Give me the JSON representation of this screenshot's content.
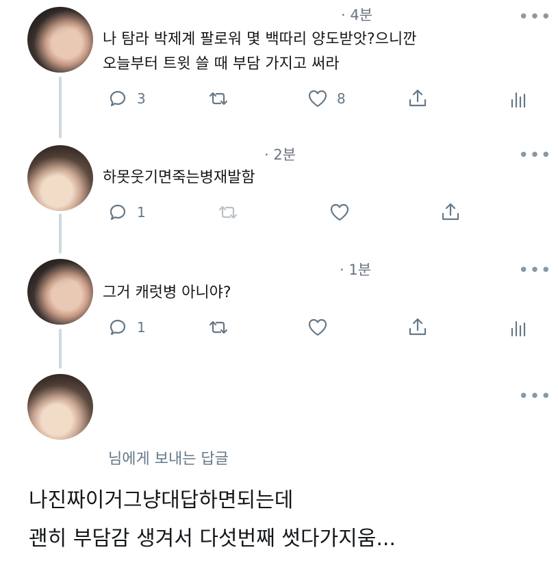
{
  "colors": {
    "text": "#14171a",
    "muted": "#657786",
    "line": "#cfd9de"
  },
  "tweets": [
    {
      "time": "· 4분",
      "lines": [
        "나 탐라 박제계 팔로워 몇 백따리 양도받앗?으니깐",
        "오늘부터 트윗 쓸 때 부담 가지고 써라"
      ],
      "reply_count": "3",
      "like_count": "8",
      "more": "•••",
      "icons": [
        "reply-icon",
        "retweet-icon",
        "like-icon",
        "share-icon",
        "analytics-icon"
      ]
    },
    {
      "time": "· 2분",
      "lines": [
        "하못웃기면죽는병재발함"
      ],
      "reply_count": "1",
      "more": "•••",
      "icons": [
        "reply-icon",
        "retweet-icon",
        "like-icon",
        "share-icon"
      ]
    },
    {
      "time": "· 1분",
      "lines": [
        "그거 캐럿병 아니야?"
      ],
      "reply_count": "1",
      "more": "•••",
      "icons": [
        "reply-icon",
        "retweet-icon",
        "like-icon",
        "share-icon",
        "analytics-icon"
      ]
    }
  ],
  "reply": {
    "more": "•••",
    "reply_to": "님에게 보내는 답글",
    "lines": [
      "나진짜이거그냥대답하면되는데",
      "괜히 부담감 생겨서 다섯번째 썻다가지움..."
    ]
  }
}
